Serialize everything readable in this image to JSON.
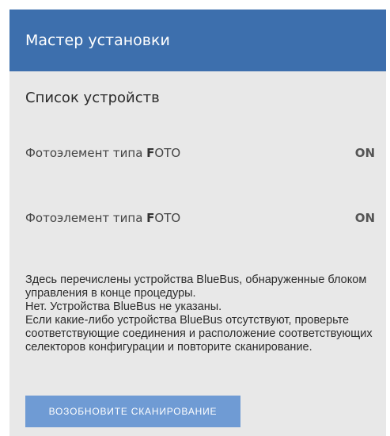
{
  "header": {
    "title": "Мастер установки"
  },
  "section": {
    "title": "Список устройств"
  },
  "devices": [
    {
      "name_prefix": "Фотоэлемент типа ",
      "name_bold": "F",
      "name_suffix": "OTO",
      "status": "ON"
    },
    {
      "name_prefix": "Фотоэлемент типа ",
      "name_bold": "F",
      "name_suffix": "OTO",
      "status": "ON"
    }
  ],
  "info": {
    "lines": [
      "Здесь перечислены устройства BlueBus, обнаруженные блоком управления в конце процедуры.",
      "Нет. Устройства BlueBus не указаны.",
      "Если какие-либо устройства BlueBus отсутствуют, проверьте соответствующие соединения и расположение соответствующих селекторов конфигурации и повторите сканирование."
    ]
  },
  "actions": {
    "rescan_label": "ВОЗОБНОВИТЕ СКАНИРОВАНИЕ"
  },
  "colors": {
    "header_bg": "#3d6fad",
    "panel_bg": "#e8e8e8",
    "button_bg": "#6f9bd4"
  }
}
